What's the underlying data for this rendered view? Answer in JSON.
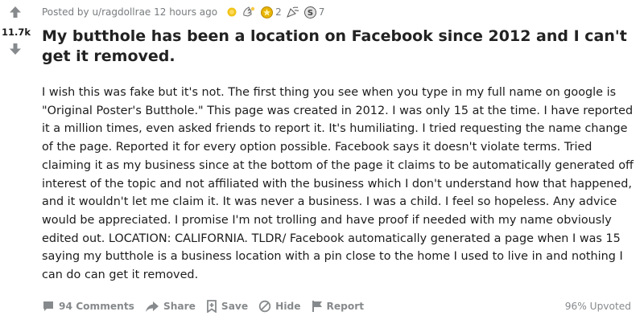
{
  "vote": {
    "score": "11.7k"
  },
  "meta": {
    "posted_by": "Posted by u/ragdollrae 12 hours ago",
    "awards": [
      {
        "icon": "silver-coin-icon",
        "count": ""
      },
      {
        "icon": "hands-icon",
        "count": ""
      },
      {
        "icon": "gold-award-icon",
        "count": "2"
      },
      {
        "icon": "party-award-icon",
        "count": ""
      },
      {
        "icon": "platinum-award-icon",
        "count": "7"
      }
    ]
  },
  "post": {
    "title": "My butthole has been a location on Facebook since 2012 and I can't get it removed.",
    "body": "I wish this was fake but it's not. The first thing you see when you type in my full name on google is \"Original Poster's Butthole.\" This page was created in 2012. I was only 15 at the time. I have reported it a million times, even asked friends to report it. It's humiliating. I tried requesting the name change of the page. Reported it for every option possible. Facebook says it doesn't violate terms. Tried claiming it as my business since at the bottom of the page it claims to be automatically generated off interest of the topic and not affiliated with the business which I don't understand how that happened, and it wouldn't let me claim it. It was never a business. I was a child. I feel so hopeless. Any advice would be appreciated. I promise I'm not trolling and have proof if needed with my name obviously edited out. LOCATION: CALIFORNIA. TLDR/ Facebook automatically generated a page when I was 15 saying my butthole is a business location with a pin close to the home I used to live in and nothing I can do can get it removed."
  },
  "footer": {
    "comments": "94 Comments",
    "share": "Share",
    "save": "Save",
    "hide": "Hide",
    "report": "Report",
    "upvoted": "96% Upvoted"
  },
  "colors": {
    "gold": "#e8b400",
    "muted": "#878a8c",
    "text": "#1a1a1b"
  }
}
